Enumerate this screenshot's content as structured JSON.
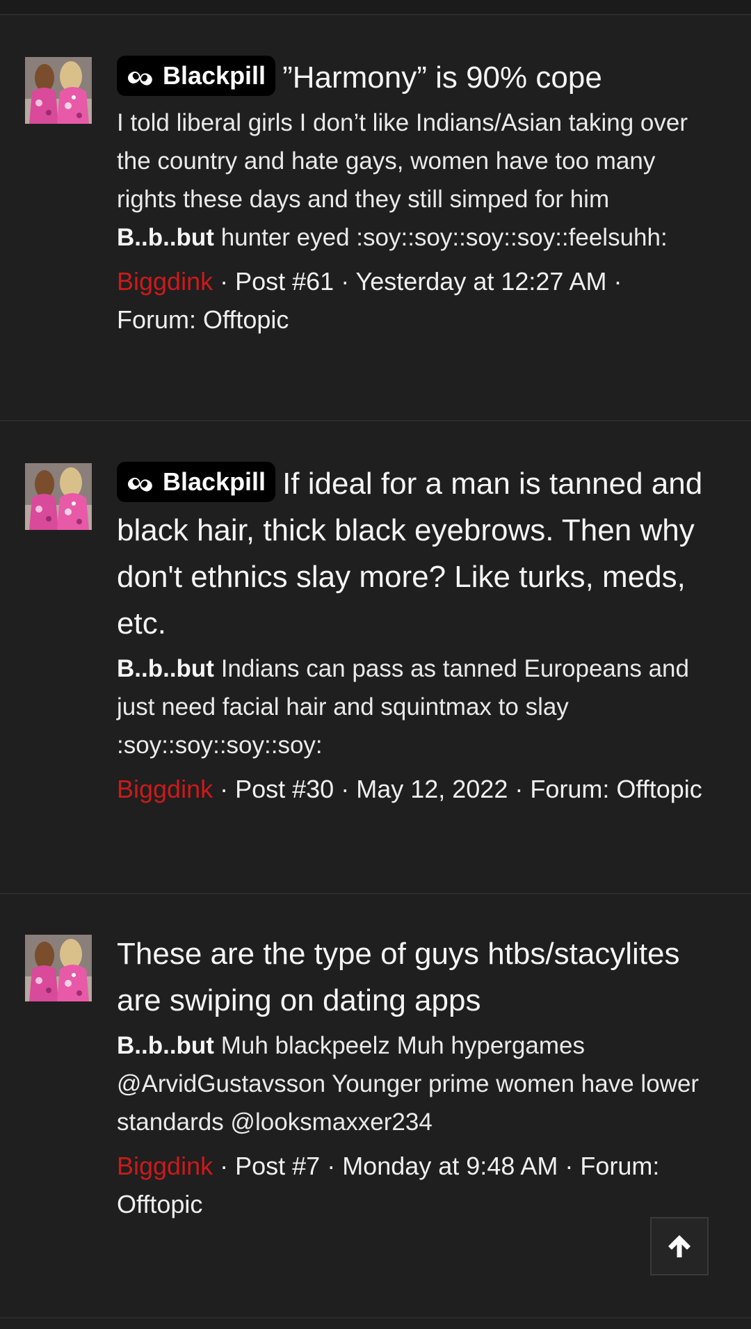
{
  "results": [
    {
      "prefix": "Blackpill",
      "title": "”Harmony” is 90% cope",
      "snippet_pre": "I told liberal girls I don’t like Indians/Asian taking over the country and hate gays, women have too many rights these days and they still simped for him ",
      "snippet_bold": "B..b..but",
      "snippet_post": " hunter eyed :soy::soy::soy::soy::feelsuhh:",
      "author": "Biggdink",
      "post": "Post #61",
      "date": "Yesterday at 12:27 AM",
      "forum_label": "Forum:",
      "forum": "Offtopic"
    },
    {
      "prefix": "Blackpill",
      "title": "If ideal for a man is tanned and black hair, thick black eyebrows. Then why don't ethnics slay more? Like turks, meds, etc.",
      "snippet_pre": "",
      "snippet_bold": "B..b..but",
      "snippet_post": " Indians can pass as tanned Europeans and just need facial hair and squintmax to slay :soy::soy::soy::soy:",
      "author": "Biggdink",
      "post": "Post #30",
      "date": "May 12, 2022",
      "forum_label": "Forum:",
      "forum": "Offtopic"
    },
    {
      "prefix": "",
      "title": "These are the type of guys htbs/stacylites are swiping on dating apps",
      "snippet_pre": "",
      "snippet_bold": "B..b..but",
      "snippet_post": " Muh blackpeelz Muh hypergames @ArvidGustavsson Younger prime women have lower standards @looksmaxxer234",
      "author": "Biggdink",
      "post": "Post #7",
      "date": "Monday at 9:48 AM",
      "forum_label": "Forum:",
      "forum": "Offtopic"
    }
  ],
  "sep": " · ",
  "icons": {
    "prefix": "pills-icon",
    "scroll_top": "arrow-up-icon"
  },
  "colors": {
    "background": "#1f1f1f",
    "author": "#cc1a1a",
    "badge_bg": "#000000"
  }
}
